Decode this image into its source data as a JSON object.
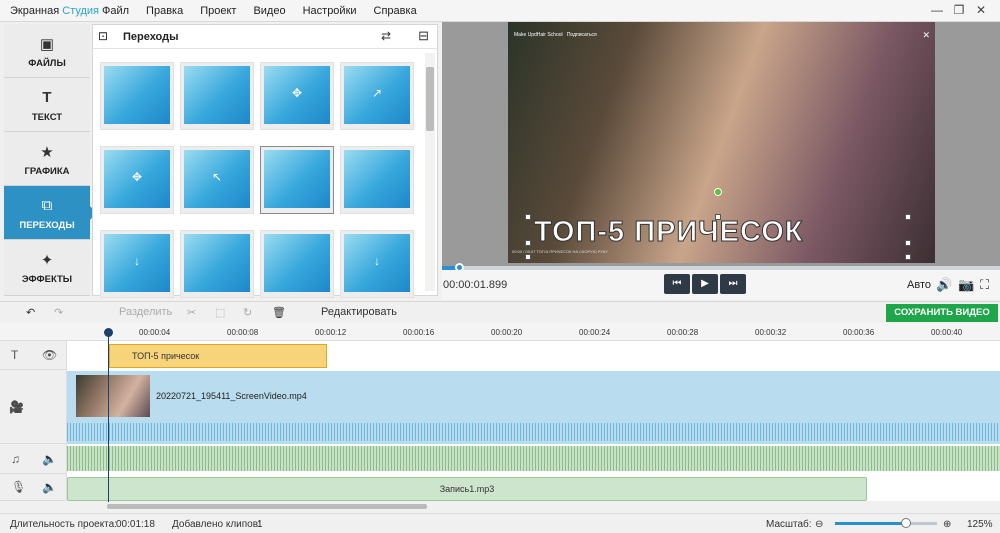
{
  "app": {
    "name_main": "Экранная",
    "name_accent": "Студия"
  },
  "menu": [
    "Файл",
    "Правка",
    "Проект",
    "Видео",
    "Настройки",
    "Справка"
  ],
  "window_controls": {
    "minimize": "—",
    "maximize": "❐",
    "close": "✕"
  },
  "sidebar": [
    {
      "label": "ФАЙЛЫ",
      "icon": "image-icon",
      "glyph": "▣"
    },
    {
      "label": "ТЕКСТ",
      "icon": "text-icon",
      "glyph": "T"
    },
    {
      "label": "ГРАФИКА",
      "icon": "star-icon",
      "glyph": "★"
    },
    {
      "label": "ПЕРЕХОДЫ",
      "icon": "transitions-icon",
      "glyph": "⧉",
      "active": true
    },
    {
      "label": "ЭФФЕКТЫ",
      "icon": "wand-icon",
      "glyph": "✦"
    }
  ],
  "panel": {
    "title": "Переходы",
    "shuffle_glyph": "⇄",
    "fullscreen_glyph": "⊟",
    "title_glyph": "⊡"
  },
  "transitions": [
    {
      "glyph": ""
    },
    {
      "glyph": ""
    },
    {
      "glyph": "✥"
    },
    {
      "glyph": "↗"
    },
    {
      "glyph": "✥"
    },
    {
      "glyph": "↖"
    },
    {
      "glyph": "",
      "selected": true
    },
    {
      "glyph": ""
    },
    {
      "glyph": "↓"
    },
    {
      "glyph": ""
    },
    {
      "glyph": ""
    },
    {
      "glyph": "↓"
    }
  ],
  "video": {
    "channel": "Make UpdHair School",
    "subscribe": "Подписаться",
    "title": "ТОП-5 ПРИЧЕСОК",
    "controls_text": "00:00 / 05:07   ТОП-5 ПРИЧЕСОК НА СКОРУЮ РУКУ",
    "close_glyph": "✕"
  },
  "player": {
    "time": "00:00:01.899",
    "prev": "⏮",
    "play": "▶",
    "next": "⏭",
    "quality": "Авто",
    "progress": 0.03,
    "icons": {
      "volume": "🔊",
      "camera": "📷",
      "fullscreen": "⛶"
    }
  },
  "toolbar": {
    "undo": "↶",
    "redo": "↷",
    "split": "Разделить",
    "cut": "✂",
    "crop": "⬚",
    "rotate": "↻",
    "delete": "🗑",
    "edit": "Редактировать",
    "save": "СОХРАНИТЬ ВИДЕО"
  },
  "ruler": [
    "00:00:04",
    "00:00:08",
    "00:00:12",
    "00:00:16",
    "00:00:20",
    "00:00:24",
    "00:00:28",
    "00:00:32",
    "00:00:36",
    "00:00:40"
  ],
  "track_icons": {
    "text": "T",
    "eye": "👁",
    "video": "🎥",
    "music": "♫",
    "speaker": "🔈",
    "mic": "🎙"
  },
  "clips": {
    "text": "ТОП-5 причесок",
    "video": "20220721_195411_ScreenVideo.mp4",
    "record": "Запись1.mp3"
  },
  "status": {
    "duration_label": "Длительность проекта:",
    "duration": "00:01:18",
    "clips_label": "Добавлено клипов:",
    "clips": "1",
    "zoom_label": "Масштаб:",
    "zoom_minus": "⊖",
    "zoom_plus": "⊕",
    "zoom": "125%",
    "zoom_level": 0.7
  }
}
